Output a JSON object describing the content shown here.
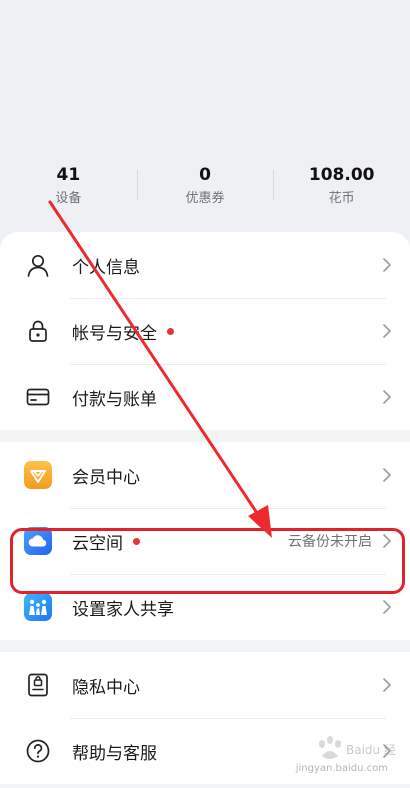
{
  "stats": [
    {
      "value": "41",
      "label": "设备"
    },
    {
      "value": "0",
      "label": "优惠券"
    },
    {
      "value": "108.00",
      "label": "花币"
    }
  ],
  "groups": [
    {
      "items": [
        {
          "label": "个人信息",
          "icon": "person-icon"
        },
        {
          "label": "帐号与安全",
          "icon": "lock-icon",
          "dot": true
        },
        {
          "label": "付款与账单",
          "icon": "card-icon"
        }
      ]
    },
    {
      "items": [
        {
          "label": "会员中心",
          "icon": "member-center-icon"
        },
        {
          "label": "云空间",
          "icon": "cloud-icon",
          "dot": true,
          "value": "云备份未开启",
          "highlighted": true
        },
        {
          "label": "设置家人共享",
          "icon": "family-share-icon"
        }
      ]
    },
    {
      "items": [
        {
          "label": "隐私中心",
          "icon": "privacy-icon"
        },
        {
          "label": "帮助与客服",
          "icon": "help-icon"
        }
      ]
    }
  ],
  "watermark": {
    "brand": "Baidu 经验",
    "domain": "jingyan.baidu.com"
  },
  "colors": {
    "accent_red": "#e1222a",
    "dot_red": "#e0363b",
    "member_orange": "#f5a623",
    "cloud_blue": "#2f7bf6",
    "family_blue": "#1f8af3"
  }
}
